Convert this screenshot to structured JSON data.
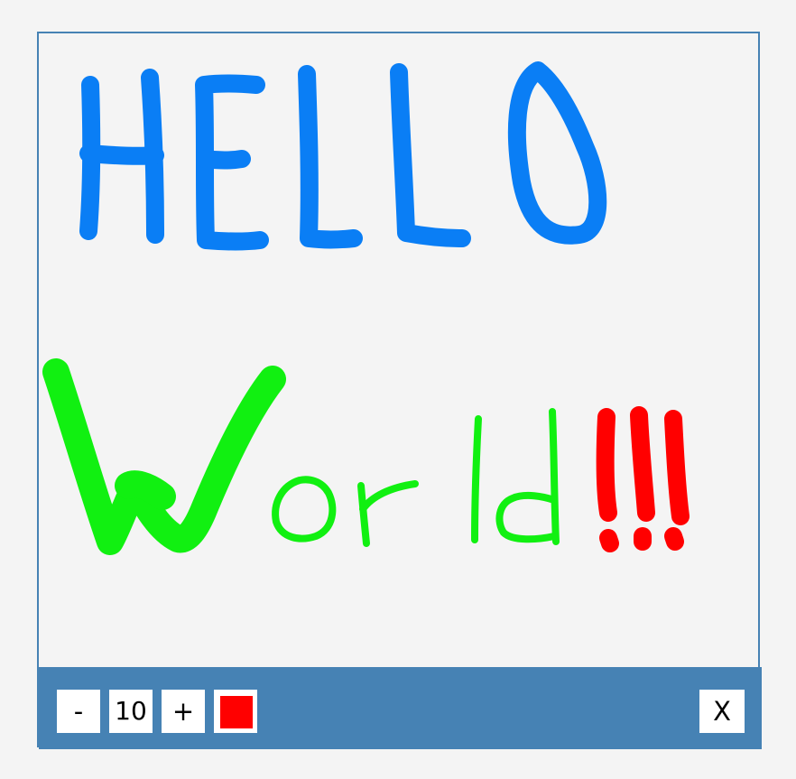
{
  "toolbar": {
    "decrease_label": "-",
    "brush_size": "10",
    "increase_label": "+",
    "close_label": "X",
    "current_color": "#ff0000"
  },
  "drawing": {
    "ink_colors": {
      "blue": "#0a7ef5",
      "green": "#11f011",
      "red": "#ff0000"
    }
  },
  "colors": {
    "frame_border": "#4682b4",
    "toolbar_bg": "#4682b4",
    "canvas_bg": "#f4f4f4",
    "button_bg": "#ffffff"
  }
}
